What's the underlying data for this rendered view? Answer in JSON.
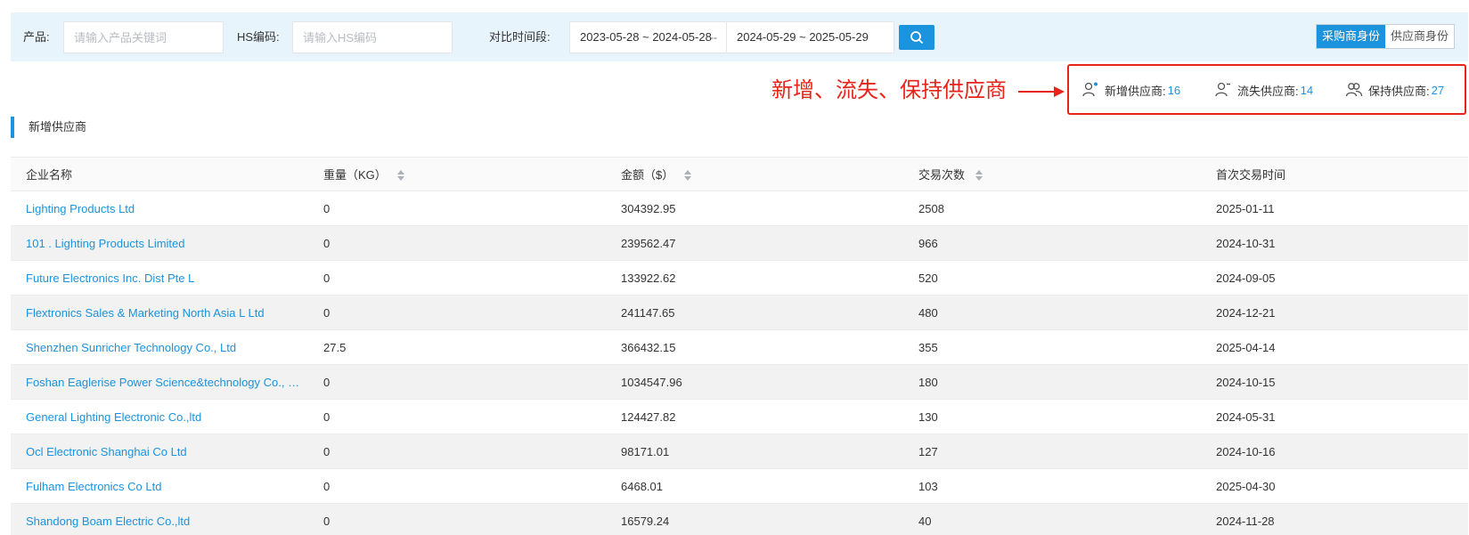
{
  "filters": {
    "product_label": "产品:",
    "product_placeholder": "请输入产品关键词",
    "hs_label": "HS编码:",
    "hs_placeholder": "请输入HS编码",
    "period_label": "对比时间段:",
    "period1": "2023-05-28 ~ 2024-05-28",
    "separator": "--",
    "period2": "2024-05-29 ~ 2025-05-29"
  },
  "roles": {
    "buyer": "采购商身份",
    "supplier": "供应商身份"
  },
  "annotation": {
    "text": "新增、流失、保持供应商"
  },
  "stats": [
    {
      "label": "新增供应商:",
      "value": "16",
      "icon": "user-plus-icon"
    },
    {
      "label": "流失供应商:",
      "value": "14",
      "icon": "user-minus-icon"
    },
    {
      "label": "保持供应商:",
      "value": "27",
      "icon": "users-icon"
    }
  ],
  "section": {
    "title": "新增供应商"
  },
  "table": {
    "headers": [
      "企业名称",
      "重量（KG）",
      "金额（$）",
      "交易次数",
      "首次交易时间"
    ],
    "rows": [
      [
        "Lighting Products Ltd",
        "0",
        "304392.95",
        "2508",
        "2025-01-11"
      ],
      [
        "101 . Lighting Products Limited",
        "0",
        "239562.47",
        "966",
        "2024-10-31"
      ],
      [
        "Future Electronics Inc. Dist Pte L",
        "0",
        "133922.62",
        "520",
        "2024-09-05"
      ],
      [
        "Flextronics Sales & Marketing North Asia L Ltd",
        "0",
        "241147.65",
        "480",
        "2024-12-21"
      ],
      [
        "Shenzhen Sunricher Technology Co., Ltd",
        "27.5",
        "366432.15",
        "355",
        "2025-04-14"
      ],
      [
        "Foshan Eaglerise Power Science&technology Co., Ltd",
        "0",
        "1034547.96",
        "180",
        "2024-10-15"
      ],
      [
        "General Lighting Electronic Co.,ltd",
        "0",
        "124427.82",
        "130",
        "2024-05-31"
      ],
      [
        "Ocl Electronic Shanghai Co Ltd",
        "0",
        "98171.01",
        "127",
        "2024-10-16"
      ],
      [
        "Fulham Electronics Co Ltd",
        "0",
        "6468.01",
        "103",
        "2025-04-30"
      ],
      [
        "Shandong Boam Electric Co.,ltd",
        "0",
        "16579.24",
        "40",
        "2024-11-28"
      ]
    ]
  },
  "colors": {
    "accent": "#1c93dd",
    "annotation": "#e8241a",
    "filter_bg": "#e8f4fc"
  }
}
